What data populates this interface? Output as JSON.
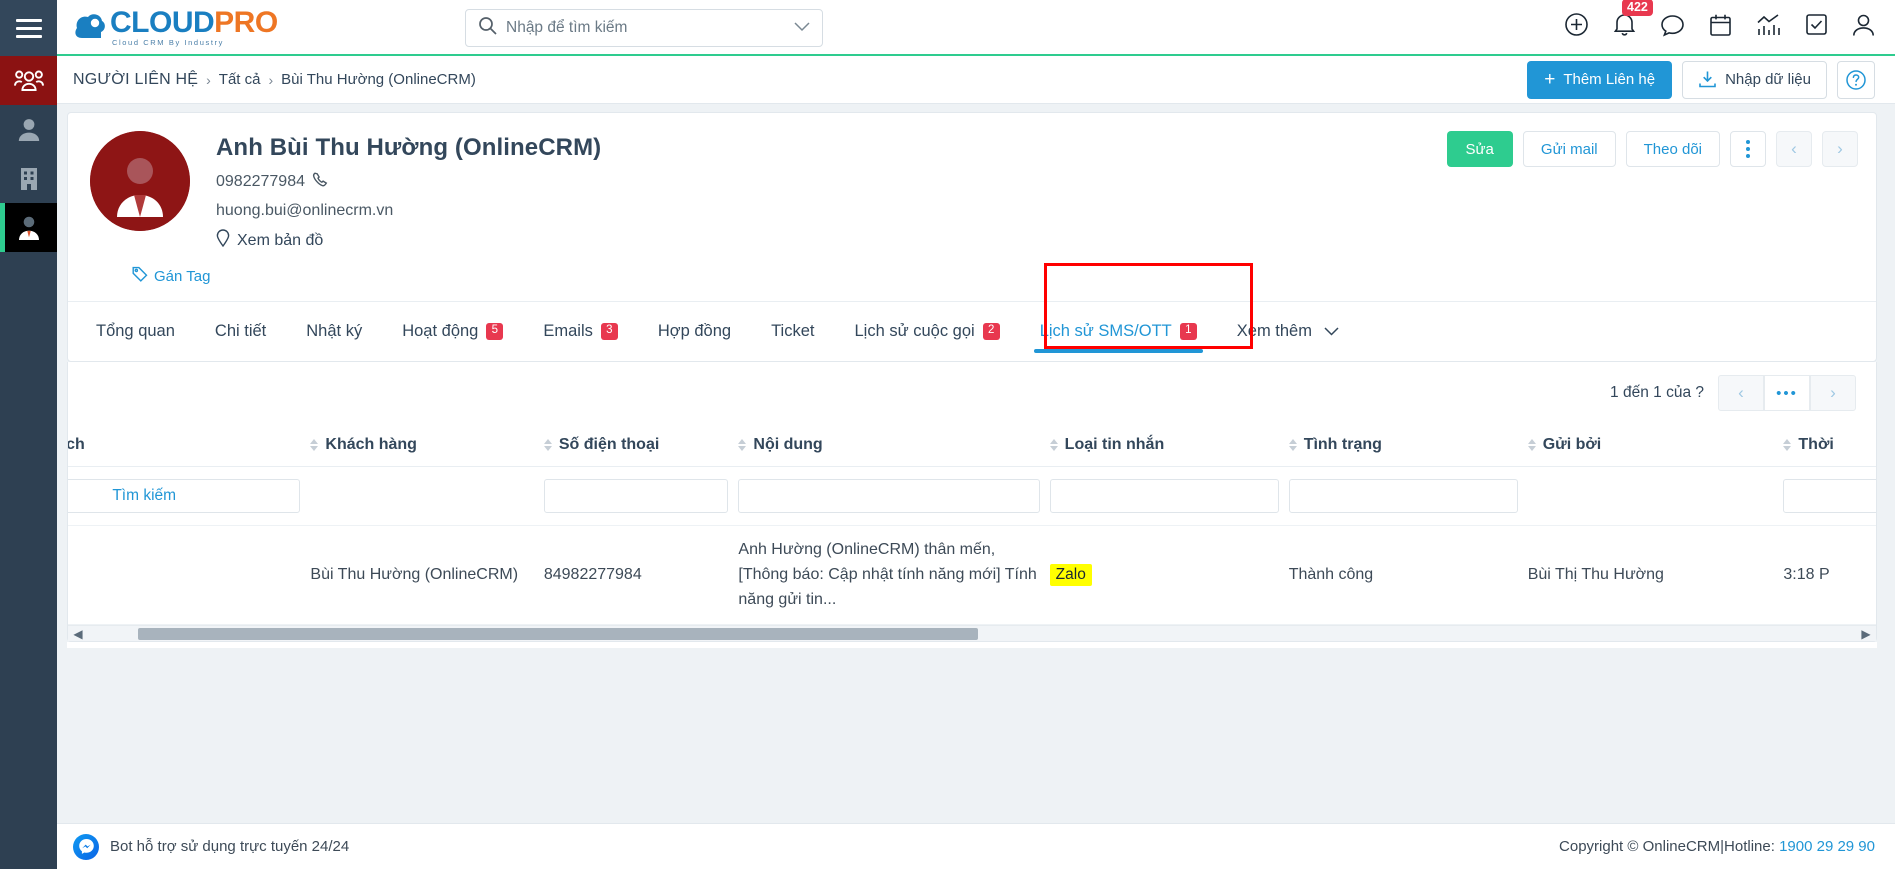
{
  "sidebar": {
    "menu_label": "menu",
    "items": [
      {
        "name": "contacts-group",
        "icon": "people-group-icon",
        "state": "active-red"
      },
      {
        "name": "person",
        "icon": "person-icon",
        "state": "normal"
      },
      {
        "name": "company",
        "icon": "building-icon",
        "state": "normal"
      },
      {
        "name": "contact-detail",
        "icon": "contact-card-icon",
        "state": "active-black"
      }
    ]
  },
  "header": {
    "logo_main_1": "CLOUD",
    "logo_main_2": "PRO",
    "logo_sub": "Cloud CRM By Industry",
    "search": {
      "placeholder": "Nhập để tìm kiếm",
      "value": "",
      "caret": "⌄"
    },
    "icons": [
      {
        "name": "add-icon",
        "label": "add"
      },
      {
        "name": "notifications-bell-icon",
        "label": "notifications",
        "badge": "422"
      },
      {
        "name": "chat-icon",
        "label": "chat"
      },
      {
        "name": "calendar-icon",
        "label": "calendar"
      },
      {
        "name": "analytics-icon",
        "label": "analytics"
      },
      {
        "name": "tasks-icon",
        "label": "tasks"
      },
      {
        "name": "user-account-icon",
        "label": "account"
      }
    ]
  },
  "breadcrumb": {
    "root": "NGƯỜI LIÊN HỆ",
    "separator": "›",
    "level2": "Tất cả",
    "current": "Bùi Thu Hường (OnlineCRM)",
    "add_contact": "Thêm Liên hệ",
    "add_contact_plus": "+",
    "import_data": "Nhập dữ liệu",
    "help": "?"
  },
  "profile": {
    "name": "Anh Bùi Thu Hường (OnlineCRM)",
    "phone": "0982277984",
    "email": "huong.bui@onlinecrm.vn",
    "map_link": "Xem bản đồ",
    "tag_label": "Gán Tag",
    "actions": {
      "edit": "Sửa",
      "send_mail": "Gửi mail",
      "follow": "Theo dõi",
      "more": "more-options",
      "prev": "‹",
      "next": "›"
    }
  },
  "tabs": [
    {
      "label": "Tổng quan",
      "badge": "",
      "active": false
    },
    {
      "label": "Chi tiết",
      "badge": "",
      "active": false
    },
    {
      "label": "Nhật ký",
      "badge": "",
      "active": false
    },
    {
      "label": "Hoạt động",
      "badge": "5",
      "active": false
    },
    {
      "label": "Emails",
      "badge": "3",
      "active": false
    },
    {
      "label": "Hợp đồng",
      "badge": "",
      "active": false
    },
    {
      "label": "Ticket",
      "badge": "",
      "active": false
    },
    {
      "label": "Lịch sử cuộc gọi",
      "badge": "2",
      "active": false
    },
    {
      "label": "Lịch sử SMS/OTT",
      "badge": "1",
      "active": true
    },
    {
      "label": "Xem thêm",
      "badge": "",
      "active": false,
      "caret": "⌄"
    }
  ],
  "pagination": {
    "summary": "1 đến 1 của ?",
    "prev": "‹",
    "ellipsis": "•••",
    "next": "›"
  },
  "table": {
    "search_button": "Tìm kiếm",
    "columns": [
      {
        "label": "Chiến dịch",
        "filter": false
      },
      {
        "label": "Khách hàng",
        "filter": false
      },
      {
        "label": "Số điện thoại",
        "filter": true
      },
      {
        "label": "Nội dung",
        "filter": true
      },
      {
        "label": "Loại tin nhắn",
        "filter": true
      },
      {
        "label": "Tình trạng",
        "filter": true
      },
      {
        "label": "Gửi bởi",
        "filter": false
      },
      {
        "label": "Thời",
        "filter": true
      }
    ],
    "rows": [
      {
        "campaign": "",
        "customer": "Bùi Thu Hường (OnlineCRM)",
        "phone": "84982277984",
        "content": "Anh Hường (OnlineCRM) thân mến,\n[Thông báo: Cập nhật tính năng mới] Tính năng gửi tin...",
        "message_type": "Zalo",
        "status": "Thành công",
        "sent_by": "Bùi Thị Thu Hường",
        "time": "3:18 P"
      }
    ]
  },
  "footer": {
    "support_text": "Bot hỗ trợ sử dụng trực tuyến 24/24",
    "copyright": "Copyright © OnlineCRM",
    "divider": "|",
    "hotline_label": "Hotline:",
    "hotline_number": "1900 29 29 90"
  },
  "colors": {
    "accent_blue": "#2196d6",
    "green": "#2ecc8f",
    "badge_red": "#e8384f",
    "avatar_red": "#8e1515",
    "highlight_yellow": "#ffff00",
    "annotation_red": "#ff0000"
  }
}
